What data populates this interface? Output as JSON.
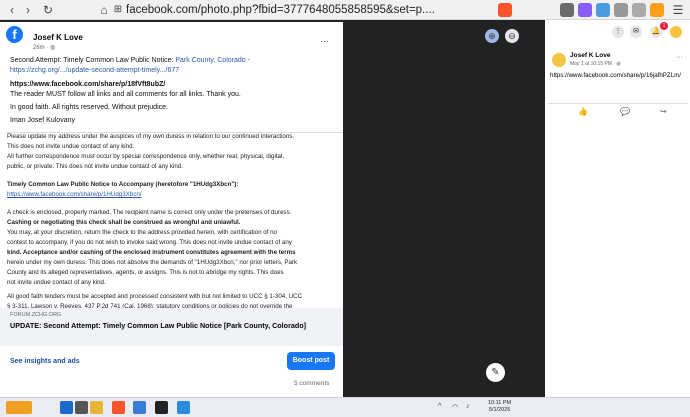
{
  "browser": {
    "url": "facebook.com/photo.php?fbid=3777648055858595&set=p....",
    "nav": {
      "back": "‹",
      "forward": "›",
      "reload": "↻",
      "home": "⌂",
      "controls": "⊞",
      "menu": "☰"
    }
  },
  "post": {
    "author": "Josef K Love",
    "time": "26m · ",
    "globe": "◍",
    "more": "···",
    "line1_prefix": "Second Attempt: Timely Common Law Public Notice: ",
    "line1_link": "Park County, Colorado -",
    "line2_link": "https://zchg.org/.../update-second-attempt-timely.../677",
    "line3": "https://www.facebook.com/share/p/18fVft8ubZ/",
    "line4": "The reader MUST follow all links and all comments for all links.  Thank you.",
    "line5": "In good faith.  All rights reserved.  Without prejudice.",
    "line6": "Iman Josef Kulovany"
  },
  "doc": {
    "lines": [
      {
        "t": "Please update my address under the auspices of my own duress in relation to our continued interactions.",
        "b": false,
        "l": false
      },
      {
        "t": "This does not invite undue contact of any kind.",
        "b": false,
        "l": false
      },
      {
        "t": "All further correspondence must occur by special correspondence only, whether real, physical, digital,",
        "b": false,
        "l": false
      },
      {
        "t": "public, or private.  This does not invite undue contact of any kind.",
        "b": false,
        "l": false
      },
      {
        "t": "Timely Common Law Public Notice to Accompany (heretofore \"1HUdg3Xbcn\"):",
        "b": true,
        "l": false
      },
      {
        "t": "https://www.facebook.com/share/p/1HUdg3Xbcn/",
        "b": false,
        "l": true
      },
      {
        "t": "A check is enclosed, properly marked. The recipient name is correct only under the pretenses of duress.",
        "b": false,
        "l": false
      },
      {
        "t": "Cashing or negotiating this check shall be construed as wrongful and unlawful.",
        "b": true,
        "l": false
      },
      {
        "t": "You may, at your discretion, return the check to the address provided herein, with certification of no",
        "b": false,
        "l": false
      },
      {
        "t": "contest to accompany, if you do not wish to invoke said wrong. This does not invite undue contact of any",
        "b": false,
        "l": false
      },
      {
        "t": "kind.  Acceptance and/or cashing of the enclosed instrument constitutes agreement with the terms",
        "b": true,
        "l": false
      },
      {
        "t": "herein under my own duress. This does not absolve the demands of \"1HUdg3Xbcn,\" nor prior letters, Park",
        "b": false,
        "l": false
      },
      {
        "t": "County and its alleged representatives, agents, or assigns.  This is not to abridge my rights.  This does",
        "b": false,
        "l": false
      },
      {
        "t": "not invite undue contact of any kind.",
        "b": false,
        "l": false
      },
      {
        "t": "All good faith tenders must be accepted and processed consistent with but not limited to UCC § 1-304, UCC",
        "b": false,
        "l": false
      },
      {
        "t": "§ 3-311, Lawson v. Reeves, 437 P.2d 741 (Cal. 1968); statutory conditions or policies do not override the",
        "b": false,
        "l": false
      }
    ]
  },
  "preview": {
    "source": "FORUM.ZCHG.ORG",
    "title": "UPDATE: Second Attempt: Timely Common Law Public Notice [Park County, Colorado]"
  },
  "actions": {
    "insights": "See insights and ads",
    "boost": "Boost post",
    "comments": "5 comments"
  },
  "viewer": {
    "zoom_in": "⊕",
    "zoom_out": "⊖",
    "edit": "✎"
  },
  "sidebar": {
    "author": "Josef K Love",
    "date": "May 1 at 10:15 PM · ",
    "text": "https://www.facebook.com/share/p/16jafhPZLm/",
    "more": "···",
    "notif_count": "1"
  },
  "taskbar": {
    "time": "10:11 PM",
    "date": "5/1/2025"
  }
}
